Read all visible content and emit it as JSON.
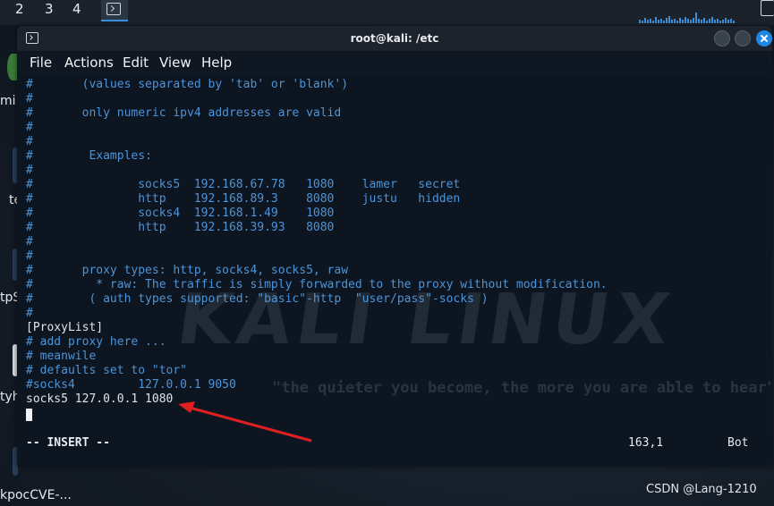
{
  "taskbar": {
    "workspaces": [
      "2",
      "3",
      "4"
    ],
    "active_app_icon": "terminal-icon"
  },
  "desktop": {
    "labels": [
      "mi",
      "te",
      "tpS",
      "tyh",
      "kpocCVE-..."
    ]
  },
  "window": {
    "title": "root@kali: /etc",
    "menu": [
      "File",
      "Actions",
      "Edit",
      "View",
      "Help"
    ]
  },
  "terminal": {
    "lines": [
      {
        "text": "#       (values separated by 'tab' or 'blank')",
        "kind": "comment"
      },
      {
        "text": "#",
        "kind": "comment"
      },
      {
        "text": "#       only numeric ipv4 addresses are valid",
        "kind": "comment"
      },
      {
        "text": "#",
        "kind": "comment"
      },
      {
        "text": "#",
        "kind": "comment"
      },
      {
        "text": "#        Examples:",
        "kind": "comment"
      },
      {
        "text": "#",
        "kind": "comment"
      },
      {
        "text": "#               socks5  192.168.67.78   1080    lamer   secret",
        "kind": "comment"
      },
      {
        "text": "#               http    192.168.89.3    8080    justu   hidden",
        "kind": "comment"
      },
      {
        "text": "#               socks4  192.168.1.49    1080",
        "kind": "comment"
      },
      {
        "text": "#               http    192.168.39.93   8080",
        "kind": "comment"
      },
      {
        "text": "#",
        "kind": "comment"
      },
      {
        "text": "#",
        "kind": "comment"
      },
      {
        "text": "#       proxy types: http, socks4, socks5, raw",
        "kind": "comment"
      },
      {
        "text": "#         * raw: The traffic is simply forwarded to the proxy without modification.",
        "kind": "comment"
      },
      {
        "text": "#        ( auth types supported: \"basic\"-http  \"user/pass\"-socks )",
        "kind": "comment"
      },
      {
        "text": "#",
        "kind": "comment"
      },
      {
        "text": "[ProxyList]",
        "kind": "text"
      },
      {
        "text": "# add proxy here ...",
        "kind": "comment"
      },
      {
        "text": "# meanwile",
        "kind": "comment"
      },
      {
        "text": "# defaults set to \"tor\"",
        "kind": "comment"
      },
      {
        "text": "#socks4         127.0.0.1 9050",
        "kind": "comment"
      },
      {
        "text": "socks5 127.0.0.1 1080",
        "kind": "text"
      }
    ],
    "status_mode": "-- INSERT --",
    "status_position": "163,1",
    "status_scroll": "Bot"
  },
  "watermark": {
    "logo_text": "KALI LINUX",
    "tagline": "\"the quieter you become, the more you are able to hear\""
  },
  "annotation": {
    "arrow_color": "#e02020",
    "credit": "CSDN @Lang-1210"
  },
  "colors": {
    "comment": "#4d94d9",
    "text": "#dde3ea",
    "accent": "#1e88e5"
  }
}
